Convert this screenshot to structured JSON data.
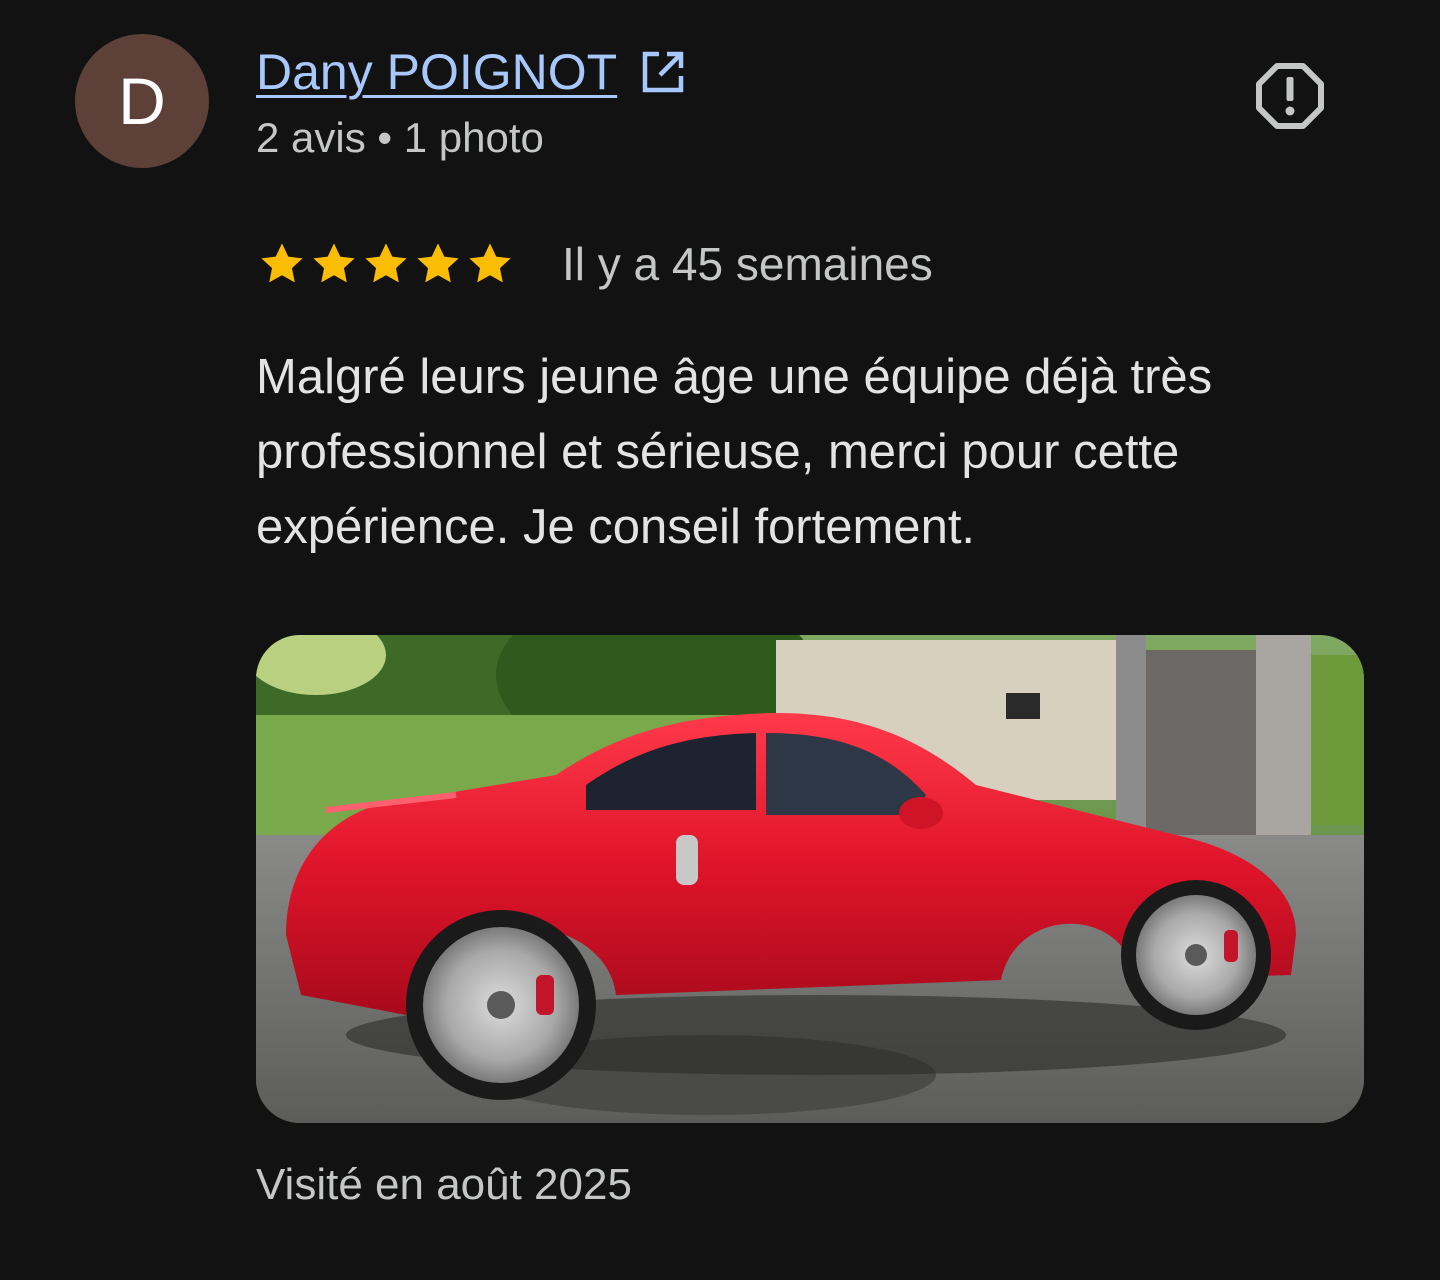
{
  "author": {
    "initial": "D",
    "name": "Dany POIGNOT",
    "meta": "2 avis • 1 photo",
    "avatar_color": "#5d4037",
    "link_icon": "open-in-new-icon"
  },
  "report_icon": "report-flag-icon",
  "rating": {
    "stars": 5,
    "max_stars": 5,
    "star_color": "#fbbc04",
    "time_ago": "Il y a 45 semaines"
  },
  "review_text": "Malgré leurs jeune âge une équipe déjà très professionnel et sérieuse, merci pour cette expérience. Je conseil fortement.",
  "photo": {
    "subject": "red sports coupe"
  },
  "visited": "Visité en août 2025",
  "colors": {
    "background": "#121212",
    "link": "#a8c7fa",
    "secondary_text": "#c4c7c5",
    "primary_text": "#e3e3e3"
  }
}
